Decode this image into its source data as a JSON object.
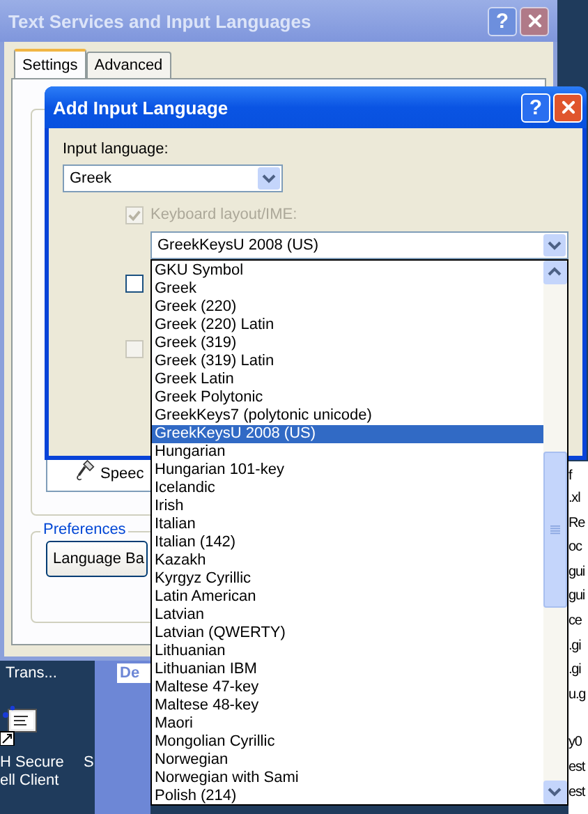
{
  "background_window": {
    "title": "Text Services and Input Languages",
    "help_button": "?",
    "tabs": [
      {
        "label": "Settings",
        "selected": true
      },
      {
        "label": "Advanced",
        "selected": false
      }
    ],
    "speech_button": "Speec",
    "preferences": {
      "label": "Preferences",
      "button": "Language Ba"
    }
  },
  "dialog": {
    "title": "Add Input Language",
    "help_button": "?",
    "input_language": {
      "label": "Input language:",
      "value": "Greek"
    },
    "checkboxes": [
      {
        "checked": false,
        "disabled": false
      },
      {
        "checked": false,
        "disabled": true
      }
    ],
    "keyboard_layout": {
      "label": "Keyboard layout/IME:",
      "checked": true,
      "disabled": true,
      "value": "GreekKeysU 2008 (US)",
      "expanded": true,
      "options": [
        {
          "label": "GKU Symbol",
          "selected": false
        },
        {
          "label": "Greek",
          "selected": false
        },
        {
          "label": "Greek (220)",
          "selected": false
        },
        {
          "label": "Greek (220) Latin",
          "selected": false
        },
        {
          "label": "Greek (319)",
          "selected": false
        },
        {
          "label": "Greek (319) Latin",
          "selected": false
        },
        {
          "label": "Greek Latin",
          "selected": false
        },
        {
          "label": "Greek Polytonic",
          "selected": false
        },
        {
          "label": "GreekKeys7 (polytonic unicode)",
          "selected": false
        },
        {
          "label": "GreekKeysU 2008 (US)",
          "selected": true
        },
        {
          "label": "Hungarian",
          "selected": false
        },
        {
          "label": "Hungarian 101-key",
          "selected": false
        },
        {
          "label": "Icelandic",
          "selected": false
        },
        {
          "label": "Irish",
          "selected": false
        },
        {
          "label": "Italian",
          "selected": false
        },
        {
          "label": "Italian (142)",
          "selected": false
        },
        {
          "label": "Kazakh",
          "selected": false
        },
        {
          "label": "Kyrgyz Cyrillic",
          "selected": false
        },
        {
          "label": "Latin American",
          "selected": false
        },
        {
          "label": "Latvian",
          "selected": false
        },
        {
          "label": "Latvian (QWERTY)",
          "selected": false
        },
        {
          "label": "Lithuanian",
          "selected": false
        },
        {
          "label": "Lithuanian IBM",
          "selected": false
        },
        {
          "label": "Maltese 47-key",
          "selected": false
        },
        {
          "label": "Maltese 48-key",
          "selected": false
        },
        {
          "label": "Maori",
          "selected": false
        },
        {
          "label": "Mongolian Cyrillic",
          "selected": false
        },
        {
          "label": "Norwegian",
          "selected": false
        },
        {
          "label": "Norwegian with Sami",
          "selected": false
        },
        {
          "label": "Polish (214)",
          "selected": false
        }
      ]
    }
  },
  "desktop": {
    "icon_labels": [
      {
        "label": "Trans..."
      },
      {
        "label": "H Secure"
      },
      {
        "label": "ell Client"
      },
      {
        "label": "S"
      }
    ],
    "tab_fragment": "De",
    "file_fragments": [
      "f",
      ".xl",
      "Re",
      "oc",
      "gui",
      "gui",
      "ce",
      ".gi",
      ".gi",
      "u.g",
      "y0",
      "est",
      "est"
    ]
  }
}
